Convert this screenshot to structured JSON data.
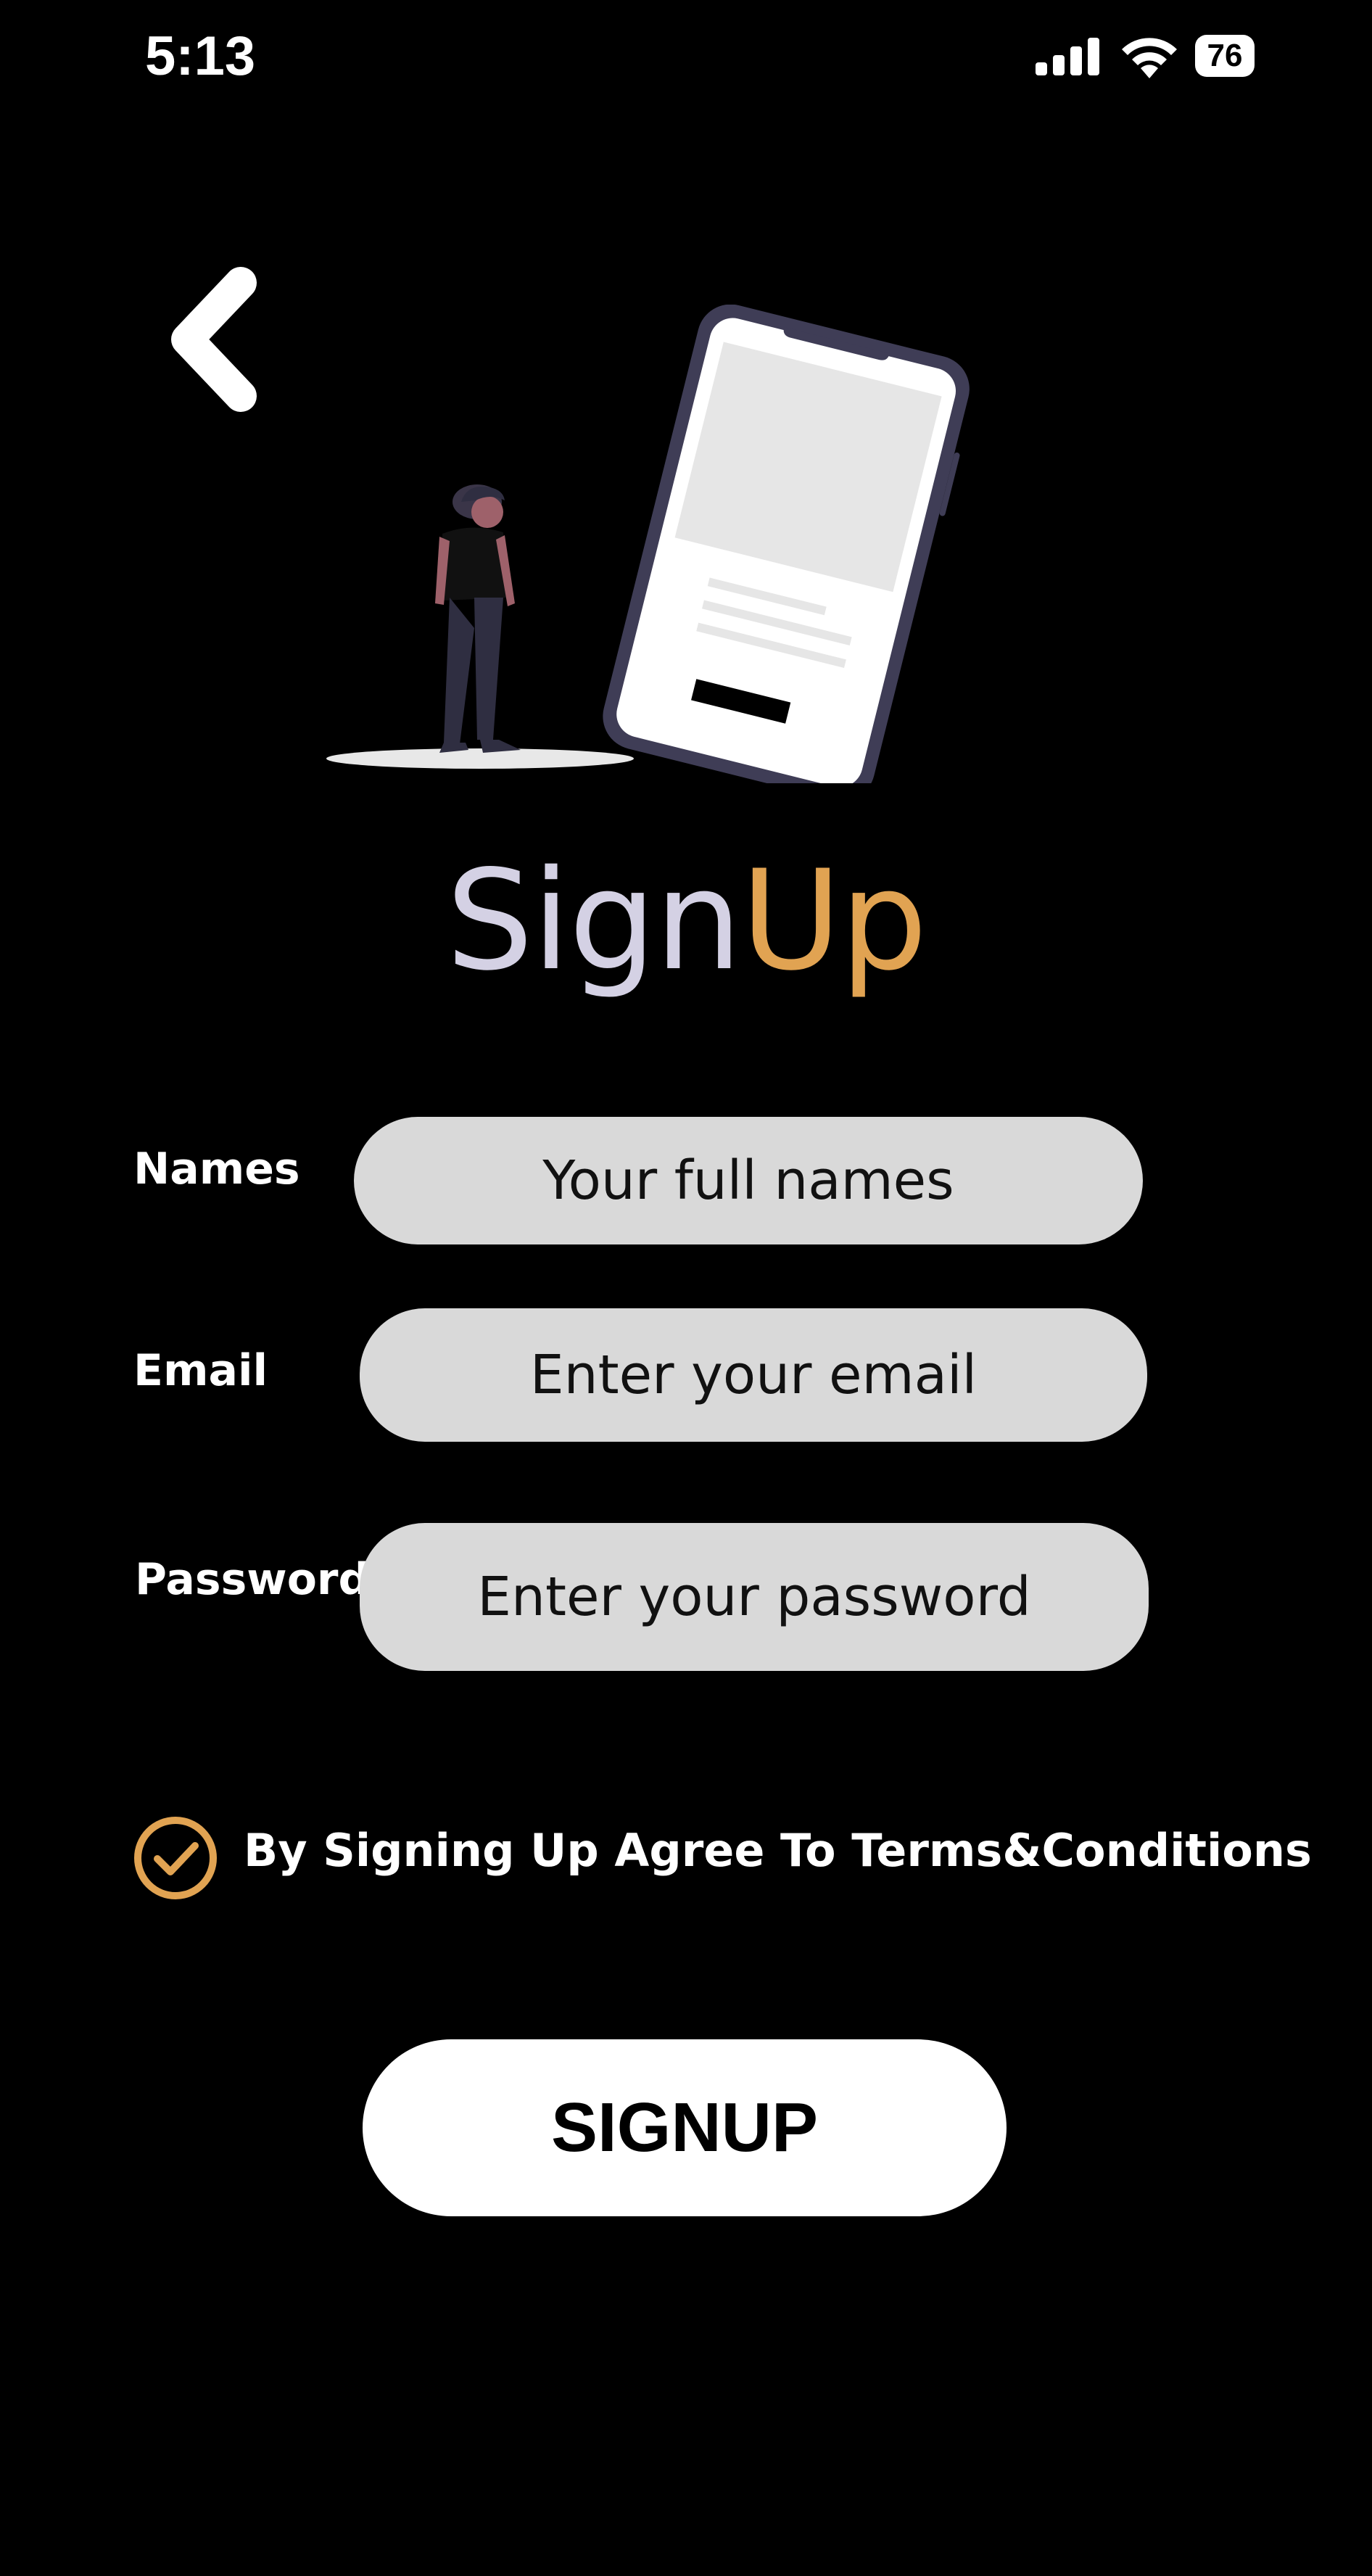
{
  "status_bar": {
    "time": "5:13",
    "battery_level": "76",
    "icons": [
      "cellular-signal-icon",
      "wifi-icon",
      "battery-icon"
    ]
  },
  "nav": {
    "back_icon": "chevron-left-icon"
  },
  "title": {
    "part1": "Sign",
    "part2": "Up"
  },
  "form": {
    "names_label": "Names",
    "names_placeholder": "Your full names",
    "email_label": "Email",
    "email_placeholder": "Enter your email",
    "password_label": "Password",
    "password_placeholder": "Enter your password"
  },
  "terms": {
    "checked": true,
    "label": "By Signing Up Agree To Terms&Conditions"
  },
  "signup_button": {
    "label": "SIGNUP"
  },
  "colors": {
    "background": "#000000",
    "accent": "#e1a352",
    "title_light": "#d4d1e4",
    "input_bg": "#d9d9d9"
  }
}
